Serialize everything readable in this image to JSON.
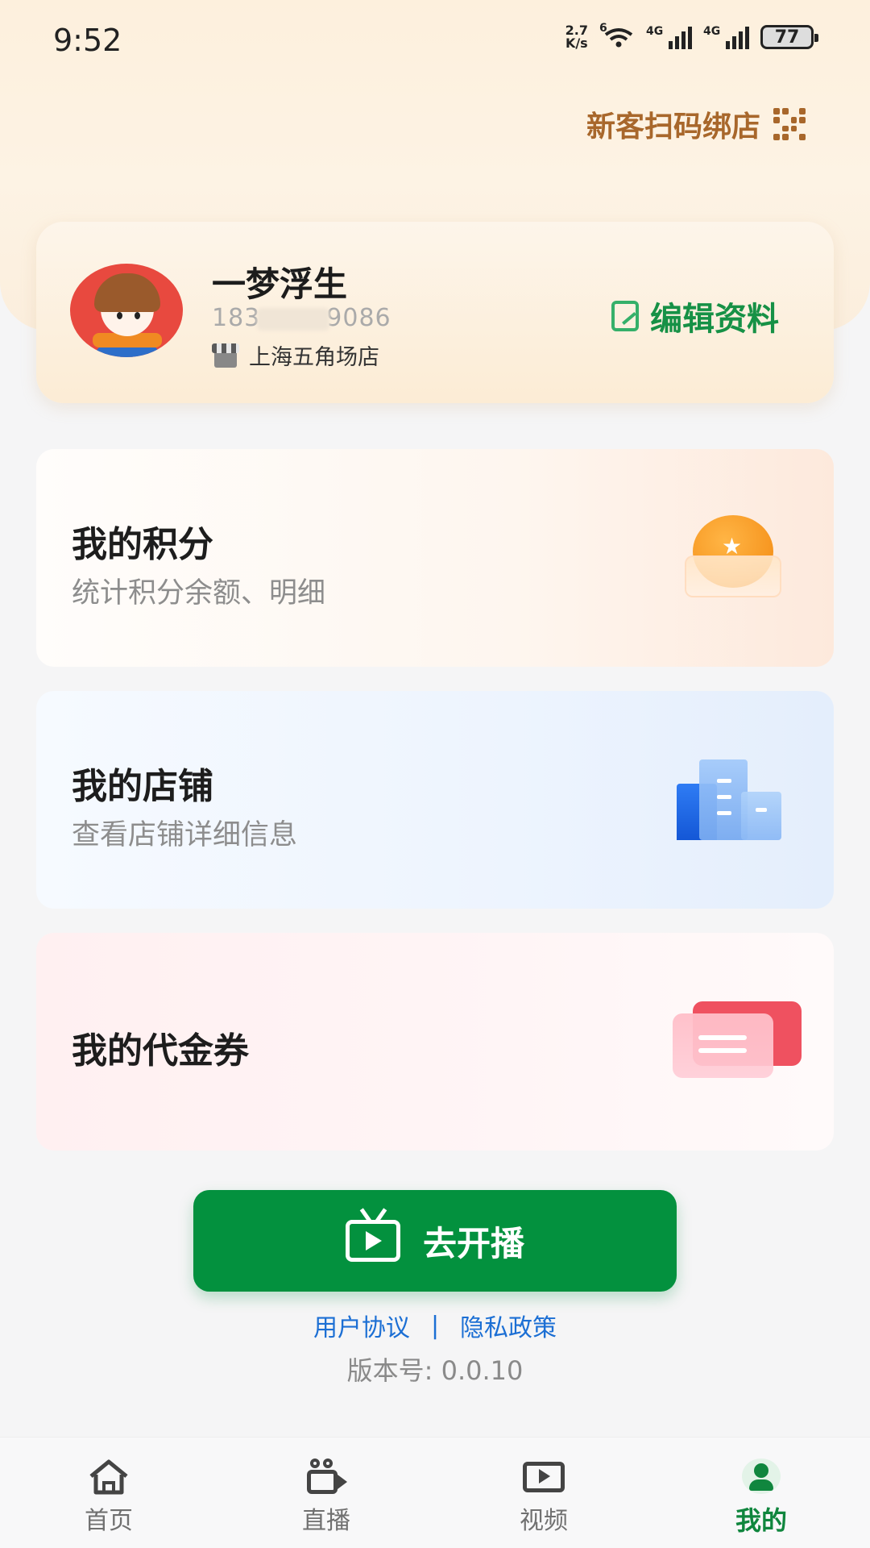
{
  "status_bar": {
    "time": "9:52",
    "net_speed_value": "2.7",
    "net_speed_unit": "K/s",
    "wifi_label": "6",
    "sim1_label": "4G",
    "sim2_label": "4G",
    "battery": "77"
  },
  "header": {
    "bind_store_label": "新客扫码绑店"
  },
  "profile": {
    "name": "一梦浮生",
    "phone_prefix": "183",
    "phone_suffix": "9086",
    "store": "上海五角场店",
    "edit_label": "编辑资料"
  },
  "menu": {
    "points": {
      "title": "我的积分",
      "subtitle": "统计积分余额、明细"
    },
    "store": {
      "title": "我的店铺",
      "subtitle": "查看店铺详细信息"
    },
    "voucher": {
      "title": "我的代金券"
    }
  },
  "go_live_label": "去开播",
  "links": {
    "user_agreement": "用户协议",
    "separator": "|",
    "privacy_policy": "隐私政策"
  },
  "version": "版本号: 0.0.10",
  "tabs": [
    {
      "label": "首页",
      "icon": "home-icon"
    },
    {
      "label": "直播",
      "icon": "live-camera-icon"
    },
    {
      "label": "视频",
      "icon": "video-icon"
    },
    {
      "label": "我的",
      "icon": "profile-icon",
      "active": true
    }
  ],
  "colors": {
    "accent_green": "#03913e",
    "bind_store_brown": "#a8672b",
    "link_blue": "#1c6fd4"
  }
}
